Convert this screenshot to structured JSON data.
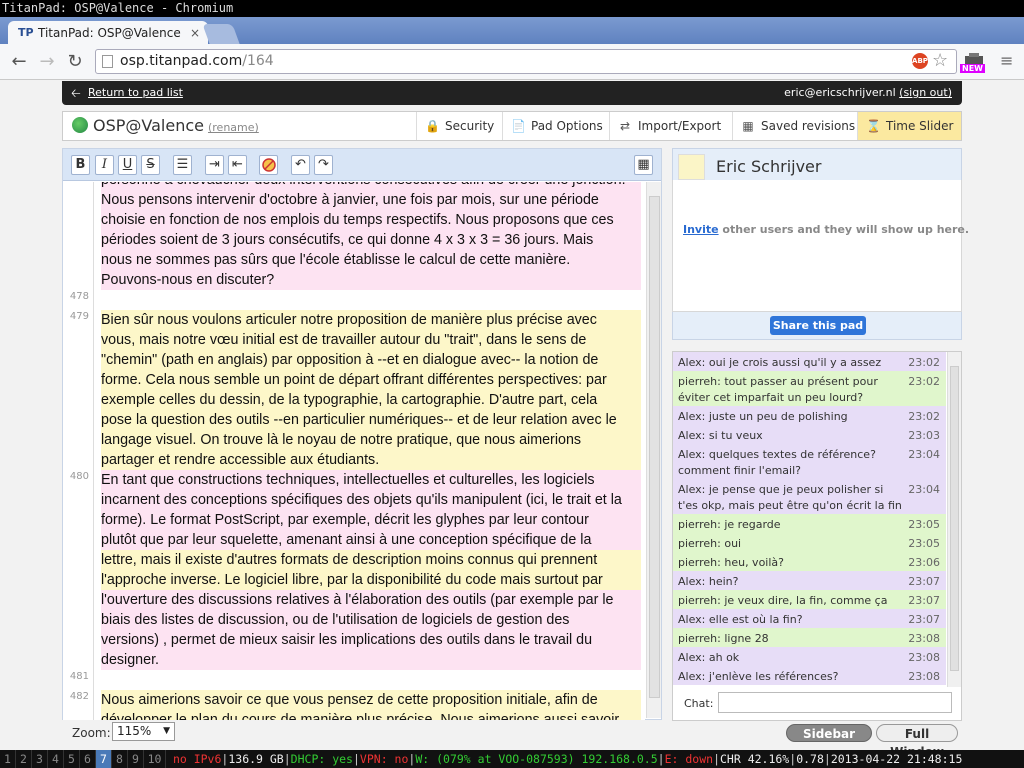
{
  "window_title": "TitanPad: OSP@Valence - Chromium",
  "tab": {
    "favicon": "TP",
    "title": "TitanPad: OSP@Valence",
    "close": "×"
  },
  "address": {
    "host": "osp.titanpad.com",
    "path": "/164"
  },
  "extension_badge": "NEW",
  "topbar": {
    "back_label": "Return to pad list",
    "user_email": "eric@ericschrijver.nl",
    "sign_out": "(sign out)"
  },
  "pad": {
    "title": "OSP@Valence",
    "rename": "(rename)"
  },
  "header_buttons": {
    "security": "Security",
    "pad_options": "Pad Options",
    "import_export": "Import/Export",
    "saved_revisions": "Saved revisions",
    "time_slider": "Time Slider"
  },
  "format_toolbar": {
    "bold": "B",
    "italic": "I",
    "underline": "U",
    "strike": "S"
  },
  "line_numbers": {
    "l478": "478",
    "l479": "479",
    "l480": "480",
    "l481": "481",
    "l482": "482"
  },
  "text": {
    "p0_l0": "personne à chevaucher deux interventions consécutives afin de créer une jonction.",
    "p0_l1": "Nous pensons  intervenir d'octobre à janvier, une fois par mois, sur une  période",
    "p0_l2": "choisie en fonction de nos emplois du temps respectifs. Nous  proposons que ces",
    "p0_l3": "périodes soient de 3 jours consécutifs, ce qui donne 4  x 3 x 3 = 36 jours. Mais",
    "p0_l4": "nous ne sommes pas sûrs que l'école établisse le calcul de cette manière.",
    "p0_l5": "Pouvons-nous en discuter?",
    "p1_l0": "Bien sûr nous voulons articuler notre proposition de manière plus précise avec",
    "p1_l1": "vous, mais notre vœu initial est de travailler autour du \"trait\", dans le sens de",
    "p1_l2": "\"chemin\" (path en anglais) par opposition à --et en dialogue avec-- la notion de",
    "p1_l3": "forme. Cela nous semble un point de départ offrant différentes perspectives: par",
    "p1_l4": "exemple celles du dessin, de la typographie, la cartographie. D'autre part, cela",
    "p1_l5": "pose la question des outils --en particulier numériques-- et de leur relation avec le",
    "p1_l6": "langage visuel. On trouve là le noyau de notre pratique, que nous aimerions",
    "p1_l7": "partager et rendre accessible aux étudiants.",
    "p2_l0": "    En tant que constructions techniques, intellectuelles et culturelles, les logiciels",
    "p2_l1": "incarnent des conceptions spécifiques des objets qu'ils manipulent (ici, le trait et la",
    "p2_l2": "forme). Le format PostScript, par exemple, décrit les glyphes par leur contour",
    "p2_l3": "plutôt que par leur squelette, amenant ainsi à une conception spécifique de la",
    "p2_l4": "lettre, mais il existe d'autres formats de description moins connus qui prennent",
    "p2_l5": "l'approche inverse. Le logiciel libre, par la disponibilité du code mais surtout par",
    "p2_l6": "l'ouverture des discussions relatives à l'élaboration des outils (par exemple par le",
    "p2_l7": "biais des listes de discussion, ou de l'utilisation de logiciels de gestion des",
    "p2_l8": "versions) , permet de mieux saisir les implications des outils dans le travail du",
    "p2_l9": "designer.",
    "p3_l0": "Nous aimerions savoir ce que vous pensez de cette proposition initiale, afin de",
    "p3_l1": "développer le plan du cours de manière plus précise. Nous aimerions aussi savoir"
  },
  "zoom": {
    "label": "Zoom:",
    "value": "115%"
  },
  "sidebar": {
    "user_name": "Eric Schrijver",
    "invite_link": "Invite",
    "invite_rest": " other users and they will show up here.",
    "share_button": "Share this pad"
  },
  "chat": {
    "messages": [
      {
        "text": "Alex: oui je crois aussi qu'il y a assez",
        "time": "23:02"
      },
      {
        "text": "pierreh: tout passer au présent pour éviter cet imparfait un peu lourd?",
        "time": "23:02"
      },
      {
        "text": "Alex: juste un peu de polishing",
        "time": "23:02"
      },
      {
        "text": "Alex: si tu veux",
        "time": "23:03"
      },
      {
        "text": "Alex: quelques textes de référence? comment finir l'email?",
        "time": "23:04"
      },
      {
        "text": "Alex: je pense que je peux polisher si t'es okp, mais peut être qu'on écrit la fin de l'email?",
        "time": "23:04"
      },
      {
        "text": "pierreh: je regarde",
        "time": "23:05"
      },
      {
        "text": "pierreh: oui",
        "time": "23:05"
      },
      {
        "text": "pierreh: heu, voilà?",
        "time": "23:06"
      },
      {
        "text": "Alex: hein?",
        "time": "23:07"
      },
      {
        "text": "pierreh: je veux dire, la fin, comme ça",
        "time": "23:07"
      },
      {
        "text": "Alex: elle est où la fin?",
        "time": "23:07"
      },
      {
        "text": "pierreh: ligne 28",
        "time": "23:08"
      },
      {
        "text": "Alex: ah ok",
        "time": "23:08"
      },
      {
        "text": "Alex: j'enlève les références?",
        "time": "23:08"
      }
    ],
    "label": "Chat:"
  },
  "bottom_buttons": {
    "sidebar": "Sidebar",
    "full_window": "Full Window"
  },
  "statusbar": {
    "workspaces": [
      "1",
      "2",
      "3",
      "4",
      "5",
      "6",
      "7",
      "8",
      "9",
      "10"
    ],
    "active": "7",
    "items": {
      "ipv6": "no IPv6",
      "disk": "136.9 GB",
      "dhcp": "DHCP: yes",
      "vpn": "VPN: no",
      "wifi": "W: (079% at VOO-087593) 192.168.0.5",
      "eth": "E: down",
      "chr": "CHR 42.16%",
      "load": "0.78",
      "datetime": "2013-04-22 21:48:15"
    }
  }
}
